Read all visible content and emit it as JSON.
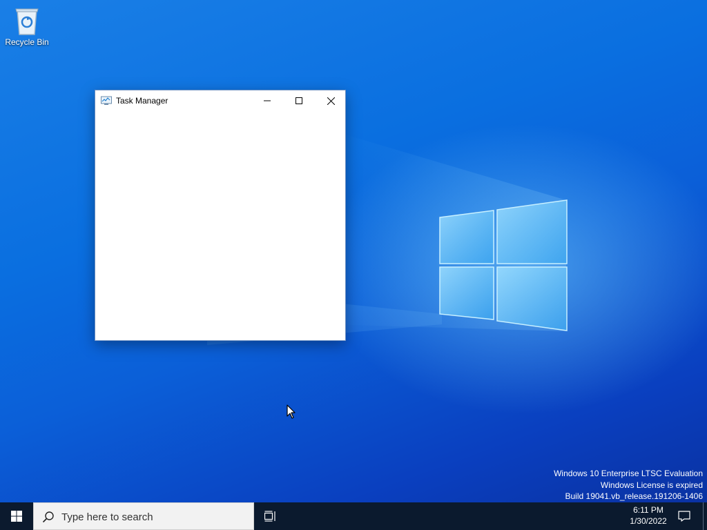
{
  "desktop": {
    "icons": [
      {
        "label": "Recycle Bin",
        "icon": "recycle-bin-icon"
      }
    ]
  },
  "window": {
    "title": "Task Manager",
    "app_icon": "task-manager-icon",
    "controls": {
      "minimize_icon": "minimize-icon",
      "maximize_icon": "maximize-icon",
      "close_icon": "close-icon"
    }
  },
  "watermark": {
    "line1": "Windows 10 Enterprise LTSC Evaluation",
    "line2": "Windows License is expired",
    "line3": "Build 19041.vb_release.191206-1406"
  },
  "taskbar": {
    "start_icon": "windows-logo-icon",
    "search": {
      "placeholder": "Type here to search",
      "icon": "search-icon"
    },
    "task_view_icon": "task-view-icon",
    "clock": {
      "time": "6:11 PM",
      "date": "1/30/2022"
    },
    "notification_icon": "notification-icon"
  },
  "colors": {
    "taskbar": "#0b1a2e",
    "desktop_accent": "#0a6fe0",
    "search_box": "#f2f2f2"
  }
}
